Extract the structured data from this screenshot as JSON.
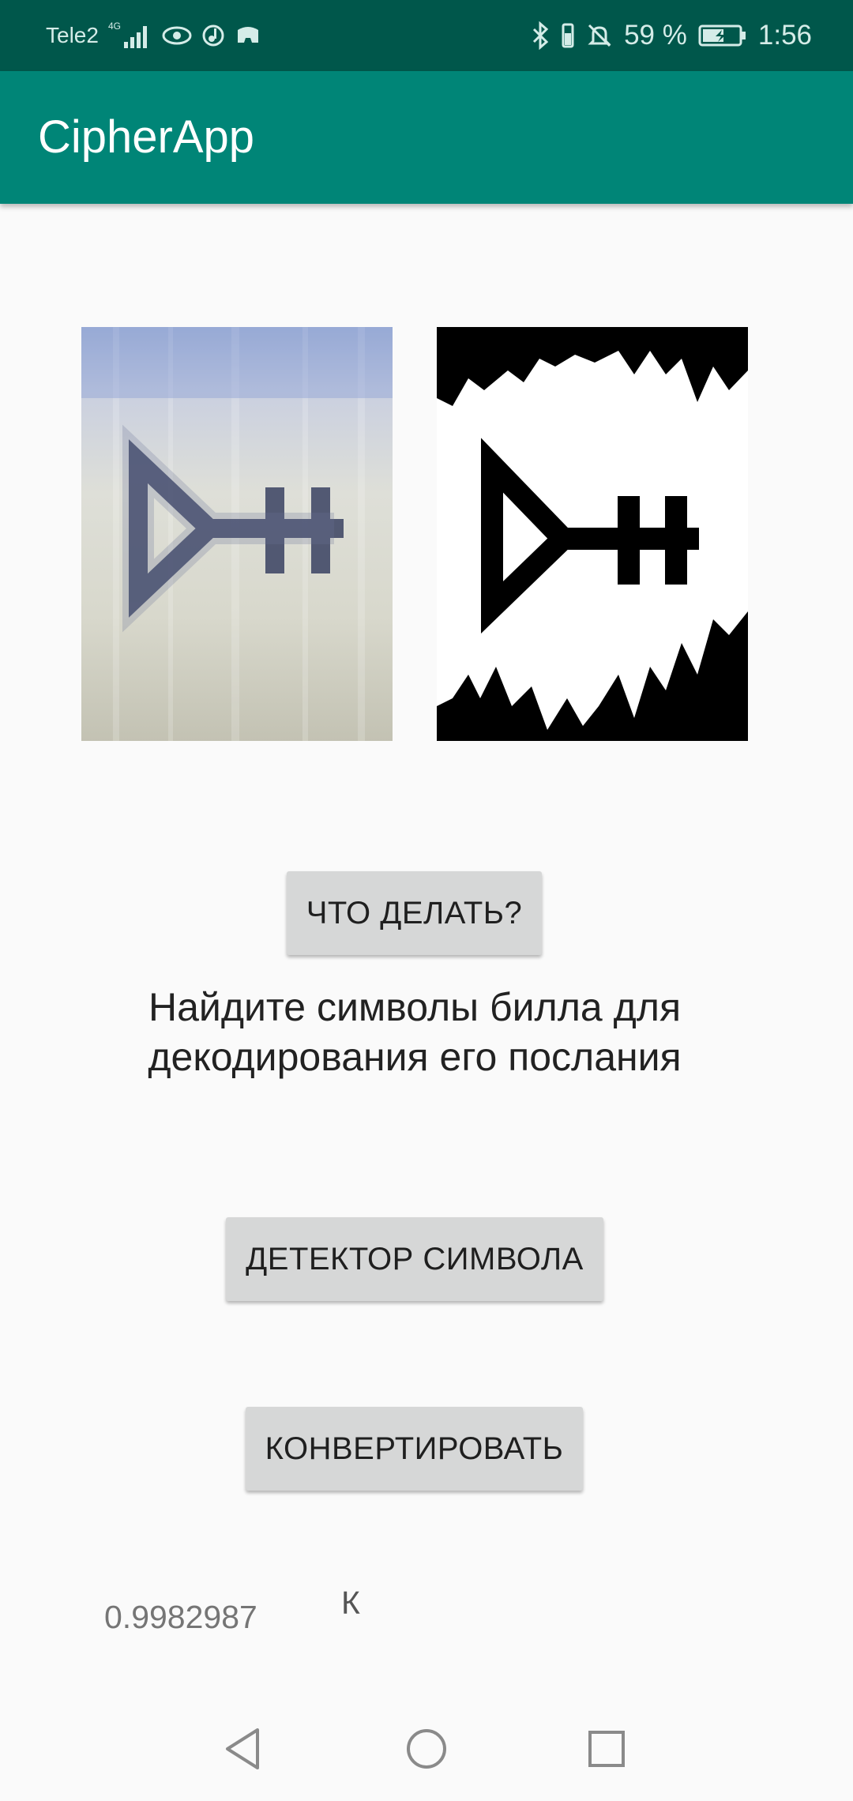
{
  "status_bar": {
    "carrier": "Tele2",
    "network": "4G",
    "battery_percent": "59 %",
    "time": "1:56",
    "battery_level": 0.59,
    "icons": [
      "signal-icon",
      "eye-icon",
      "music-icon",
      "game-icon",
      "bluetooth-icon",
      "vibrate-icon",
      "mute-icon",
      "battery-icon"
    ]
  },
  "app_bar": {
    "title": "CipherApp"
  },
  "images": {
    "original": {
      "name": "original-photo"
    },
    "processed": {
      "name": "binarized-photo"
    }
  },
  "buttons": {
    "what_to_do": "ЧТО ДЕЛАТЬ?",
    "detector": "ДЕТЕКТОР СИМВОЛА",
    "convert": "КОНВЕРТИРОВАТЬ"
  },
  "instruction_text": "Найдите символы билла для декодирования его послания",
  "result": {
    "confidence": "0.9982987",
    "letter": "К"
  },
  "nav_bar": {
    "icons": [
      "back-icon",
      "home-icon",
      "recents-icon"
    ]
  },
  "colors": {
    "status_bar": "#00574b",
    "app_bar": "#008577",
    "background": "#fafafa",
    "button": "#d6d7d7"
  }
}
